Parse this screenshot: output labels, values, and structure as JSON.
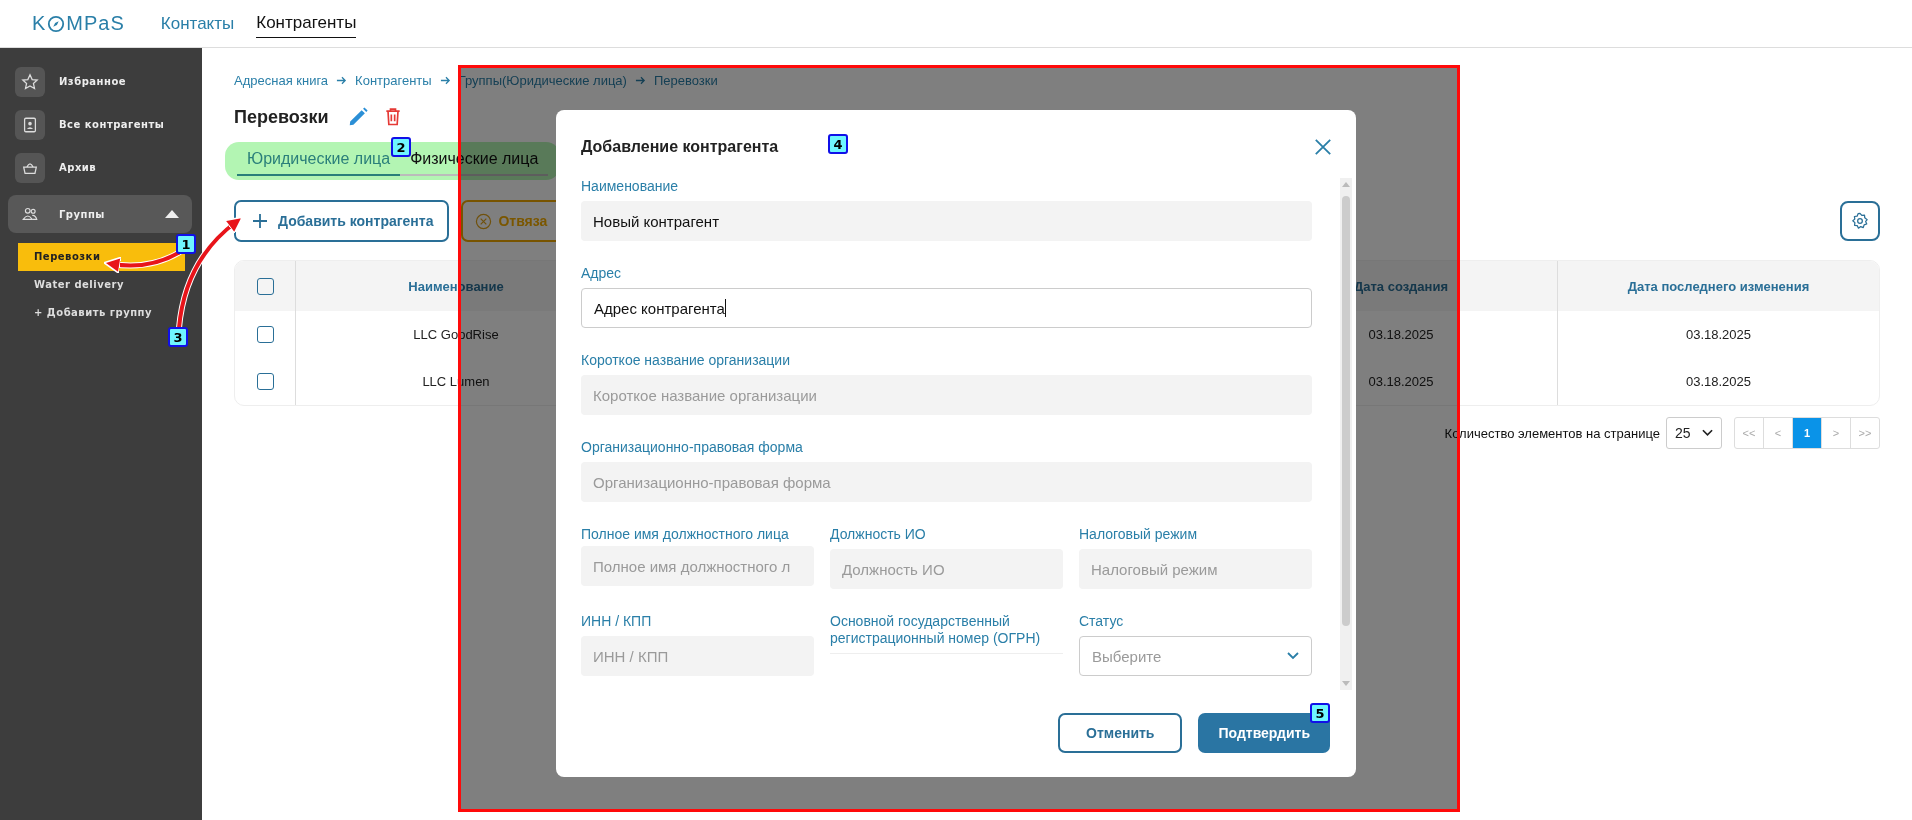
{
  "header": {
    "logo_start": "K",
    "logo_end": "MPaS",
    "nav": [
      {
        "label": "Контакты",
        "selected": false
      },
      {
        "label": "Контрагенты",
        "selected": true
      }
    ]
  },
  "sidebar": {
    "items": [
      {
        "label": "Избранное"
      },
      {
        "label": "Все контрагенты"
      },
      {
        "label": "Архив"
      },
      {
        "label": "Группы",
        "expanded": true,
        "children": [
          {
            "label": "Перевозки",
            "selected": true
          },
          {
            "label": "Water delivery",
            "selected": false
          }
        ],
        "add_label": "+ Добавить группу"
      }
    ]
  },
  "main": {
    "breadcrumb": [
      "Адресная книга",
      "Контрагенты",
      "Группы(Юридические лица)",
      "Перевозки"
    ],
    "title": "Перевозки",
    "tabs_highlighted": true,
    "tabs": [
      {
        "label": "Юридические лица",
        "selected": true
      },
      {
        "label": "Физические лица",
        "selected": false
      }
    ],
    "add_button": "Добавить контрагента",
    "unlink_button": "Отвяза",
    "table": {
      "header_checked": false,
      "columns": [
        "Наименование",
        "Дата создания",
        "Дата последнего изменения"
      ],
      "rows": [
        {
          "checked": false,
          "cells": [
            "LLC GoodRise",
            "03.18.2025",
            "03.18.2025"
          ]
        },
        {
          "checked": false,
          "cells": [
            "LLC Lumen",
            "03.18.2025",
            "03.18.2025"
          ]
        }
      ]
    },
    "pagination": {
      "label": "Количество элементов на странице",
      "page_size": "25",
      "pages": [
        {
          "label": "<<",
          "selected": false
        },
        {
          "label": "<",
          "selected": false
        },
        {
          "label": "1",
          "selected": true
        },
        {
          "label": ">",
          "selected": false
        },
        {
          "label": ">>",
          "selected": false
        }
      ]
    }
  },
  "modal": {
    "title": "Добавление контрагента",
    "rows": [
      [
        {
          "kind": "filled",
          "label": "Наименование",
          "value": "Новый контрагент"
        }
      ],
      [
        {
          "kind": "focused",
          "label": "Адрес",
          "value": "Адрес контрагента"
        }
      ],
      [
        {
          "kind": "text",
          "label": "Короткое название организации",
          "placeholder": "Короткое название организации"
        }
      ],
      [
        {
          "kind": "text",
          "label": "Организационно-правовая форма",
          "placeholder": "Организационно-правовая форма"
        }
      ],
      [
        {
          "kind": "text",
          "label": "Полное имя должностного лица",
          "placeholder": "Полное имя должностного л"
        },
        {
          "kind": "text",
          "label": "Должность ИО",
          "placeholder": "Должность ИО"
        },
        {
          "kind": "text",
          "label": "Налоговый режим",
          "placeholder": "Налоговый режим"
        }
      ],
      [
        {
          "kind": "text",
          "label": "ИНН / КПП",
          "placeholder": "ИНН / КПП"
        },
        {
          "kind": "blank",
          "label": "Основной государственный регистрационный номер (ОГРН)"
        },
        {
          "kind": "select",
          "label": "Статус",
          "placeholder": "Выберите"
        }
      ]
    ],
    "cancel_button": "Отменить",
    "confirm_button": "Подтвердить"
  },
  "annotations": {
    "badges": [
      "1",
      "2",
      "3",
      "4",
      "5"
    ]
  }
}
